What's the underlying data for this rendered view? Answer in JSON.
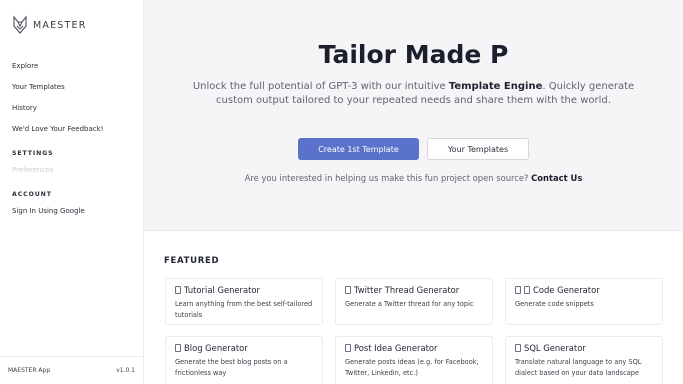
{
  "sidebar": {
    "logo_text": "MAESTER",
    "nav": [
      "Explore",
      "Your Templates",
      "History",
      "We'd Love Your Feedback!"
    ],
    "settings_label": "SETTINGS",
    "settings_item": "Preferences",
    "account_label": "ACCOUNT",
    "account_item": "Sign In Using Google",
    "footer_app": "MAESTER App",
    "footer_version": "v1.0.1"
  },
  "hero": {
    "title": "Tailor Made P",
    "sub_lead": "Unlock the full potential of GPT-3 with our intuitive ",
    "sub_bold": "Template Engine",
    "sub_tail": ". Quickly generate custom output tailored to your repeated needs and share them with the world.",
    "primary_button": "Create 1st Template",
    "secondary_button": "Your Templates",
    "cta_text": "Are you interested in helping us make this fun project open source? ",
    "cta_link": "Contact Us"
  },
  "featured": {
    "label": "FEATURED",
    "cards": [
      {
        "title": "Tutorial Generator",
        "icon": "document-icon",
        "desc": "Learn anything from the best self-tailored tutorials"
      },
      {
        "title": "Twitter Thread Generator",
        "icon": "document-icon",
        "desc": "Generate a Twitter thread for any topic"
      },
      {
        "title": "Code Generator",
        "icon": "code-icon",
        "desc": "Generate code snippets"
      },
      {
        "title": "Blog Generator",
        "icon": "document-icon",
        "desc": "Generate the best blog posts on a frictionless way"
      },
      {
        "title": "Post Idea Generator",
        "icon": "document-icon",
        "desc": "Generate posts ideas (e.g. for Facebook, Twitter, Linkedin, etc.)"
      },
      {
        "title": "SQL Generator",
        "icon": "document-icon",
        "desc": "Translate natural language to any SQL dialect based on your data landscape"
      }
    ]
  }
}
